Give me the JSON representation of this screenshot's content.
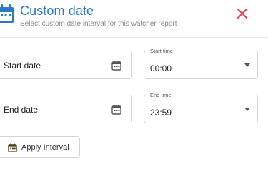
{
  "header": {
    "title": "Custom date",
    "subtitle": "Select custom date interval for this watcher report",
    "icon": "calendar-icon",
    "close_icon": "close-icon"
  },
  "start_date": {
    "placeholder": "Start date",
    "icon": "calendar-icon"
  },
  "end_date": {
    "placeholder": "End date",
    "icon": "calendar-icon"
  },
  "start_time": {
    "label": "Start time",
    "value": "00:00",
    "icon": "chevron-down-icon"
  },
  "end_time": {
    "label": "End time",
    "value": "23:59",
    "icon": "chevron-down-icon"
  },
  "apply_button": {
    "label": "Apply Interval",
    "icon": "calendar-icon"
  },
  "colors": {
    "accent": "#2b78c4",
    "close": "#e5404a",
    "icon": "#555555",
    "border": "#d4d4d4"
  }
}
